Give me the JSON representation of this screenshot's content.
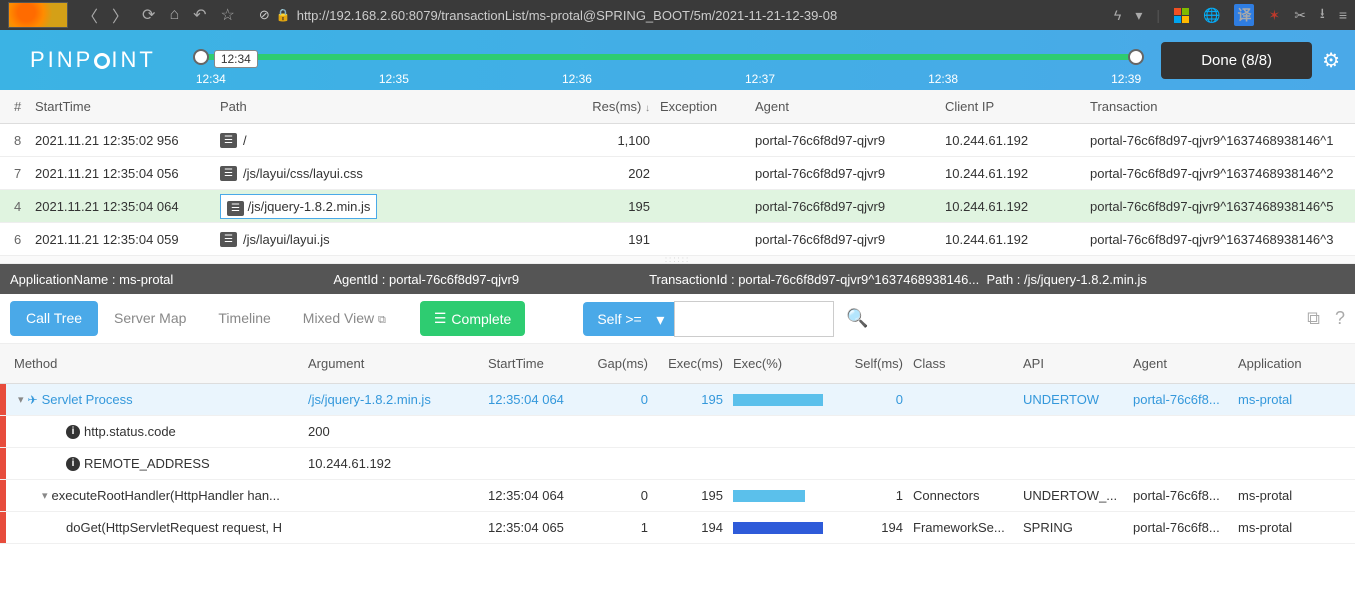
{
  "browser": {
    "url": "http://192.168.2.60:8079/transactionList/ms-protal@SPRING_BOOT/5m/2021-11-21-12-39-08"
  },
  "logo": "PINP  INT",
  "timeline": {
    "tooltip": "12:34",
    "ticks": [
      "12:34",
      "12:35",
      "12:36",
      "12:37",
      "12:38",
      "12:39"
    ]
  },
  "done_label": "Done (8/8)",
  "columns": {
    "idx": "#",
    "start": "StartTime",
    "path": "Path",
    "res": "Res(ms)",
    "exc": "Exception",
    "agent": "Agent",
    "ip": "Client IP",
    "trans": "Transaction"
  },
  "rows": [
    {
      "idx": "8",
      "start": "2021.11.21 12:35:02 956",
      "path": "/",
      "res": "1,100",
      "agent": "portal-76c6f8d97-qjvr9",
      "ip": "10.244.61.192",
      "trans": "portal-76c6f8d97-qjvr9^1637468938146^1"
    },
    {
      "idx": "7",
      "start": "2021.11.21 12:35:04 056",
      "path": "/js/layui/css/layui.css",
      "res": "202",
      "agent": "portal-76c6f8d97-qjvr9",
      "ip": "10.244.61.192",
      "trans": "portal-76c6f8d97-qjvr9^1637468938146^2"
    },
    {
      "idx": "4",
      "start": "2021.11.21 12:35:04 064",
      "path": "/js/jquery-1.8.2.min.js",
      "res": "195",
      "agent": "portal-76c6f8d97-qjvr9",
      "ip": "10.244.61.192",
      "trans": "portal-76c6f8d97-qjvr9^1637468938146^5",
      "selected": true
    },
    {
      "idx": "6",
      "start": "2021.11.21 12:35:04 059",
      "path": "/js/layui/layui.js",
      "res": "191",
      "agent": "portal-76c6f8d97-qjvr9",
      "ip": "10.244.61.192",
      "trans": "portal-76c6f8d97-qjvr9^1637468938146^3"
    }
  ],
  "detail": {
    "app_label": "ApplicationName :",
    "app": "ms-protal",
    "agent_label": "AgentId :",
    "agent": "portal-76c6f8d97-qjvr9",
    "trans_label": "TransactionId :",
    "trans": "portal-76c6f8d97-qjvr9^1637468938146...",
    "path_label": "Path :",
    "path": "/js/jquery-1.8.2.min.js"
  },
  "tabs": {
    "calltree": "Call Tree",
    "servermap": "Server Map",
    "timeline": "Timeline",
    "mixed": "Mixed View"
  },
  "complete_label": "Complete",
  "self_filter": "Self >=",
  "tree_cols": {
    "method": "Method",
    "arg": "Argument",
    "start": "StartTime",
    "gap": "Gap(ms)",
    "exec": "Exec(ms)",
    "execpct": "Exec(%)",
    "self": "Self(ms)",
    "class": "Class",
    "api": "API",
    "agent": "Agent",
    "app": "Application"
  },
  "tree": [
    {
      "marker": true,
      "hl": true,
      "indent": 0,
      "expand": "▾",
      "icon": "plane",
      "method": "Servlet Process",
      "arg": "/js/jquery-1.8.2.min.js",
      "start": "12:35:04 064",
      "gap": "0",
      "exec": "195",
      "pct": 100,
      "color": "#5bc0eb",
      "self": "0",
      "class": "",
      "api": "UNDERTOW",
      "agent": "portal-76c6f8...",
      "app": "ms-protal"
    },
    {
      "marker": true,
      "indent": 2,
      "icon": "info",
      "method": "http.status.code",
      "arg": "200"
    },
    {
      "marker": true,
      "indent": 2,
      "icon": "info",
      "method": "REMOTE_ADDRESS",
      "arg": "10.244.61.192"
    },
    {
      "marker": true,
      "indent": 1,
      "expand": "▾",
      "method": "executeRootHandler(HttpHandler han...",
      "start": "12:35:04 064",
      "gap": "0",
      "exec": "195",
      "pct": 80,
      "color": "#5bc0eb",
      "self": "1",
      "class": "Connectors",
      "api": "UNDERTOW_...",
      "agent": "portal-76c6f8...",
      "app": "ms-protal"
    },
    {
      "marker": true,
      "indent": 2,
      "method": "doGet(HttpServletRequest request, H",
      "start": "12:35:04 065",
      "gap": "1",
      "exec": "194",
      "pct": 100,
      "color": "#2e5bd9",
      "self": "194",
      "class": "FrameworkSe...",
      "api": "SPRING",
      "agent": "portal-76c6f8...",
      "app": "ms-protal"
    }
  ]
}
